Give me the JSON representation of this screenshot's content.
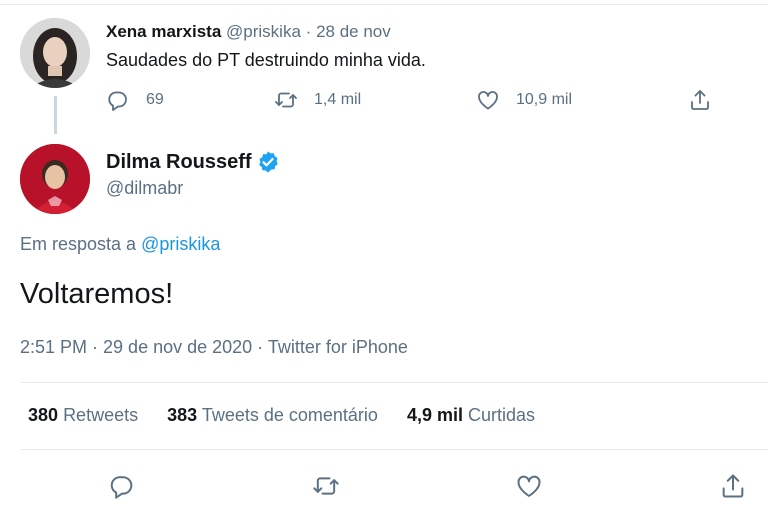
{
  "parent_tweet": {
    "name": "Xena marxista",
    "handle": "@priskika",
    "separator": "·",
    "date": "28 de nov",
    "text": "Saudades do PT destruindo minha vida.",
    "replies": "69",
    "retweets": "1,4 mil",
    "likes": "10,9 mil"
  },
  "tweet": {
    "name": "Dilma Rousseff",
    "verified": true,
    "handle": "@dilmabr",
    "reply_prefix": "Em resposta a",
    "reply_mention": "@priskika",
    "text": "Voltaremos!",
    "meta": "2:51 PM · 29 de nov de 2020 · Twitter for iPhone",
    "retweets_count": "380",
    "retweets_label": "Retweets",
    "quotes_count": "383",
    "quotes_label": "Tweets de comentário",
    "likes_count": "4,9 mil",
    "likes_label": "Curtidas"
  },
  "colors": {
    "link": "#1b95e0",
    "muted": "#5b7083",
    "verified": "#1da1f2"
  },
  "icons": [
    "reply-icon",
    "retweet-icon",
    "like-icon",
    "share-icon",
    "verified-badge-icon"
  ]
}
